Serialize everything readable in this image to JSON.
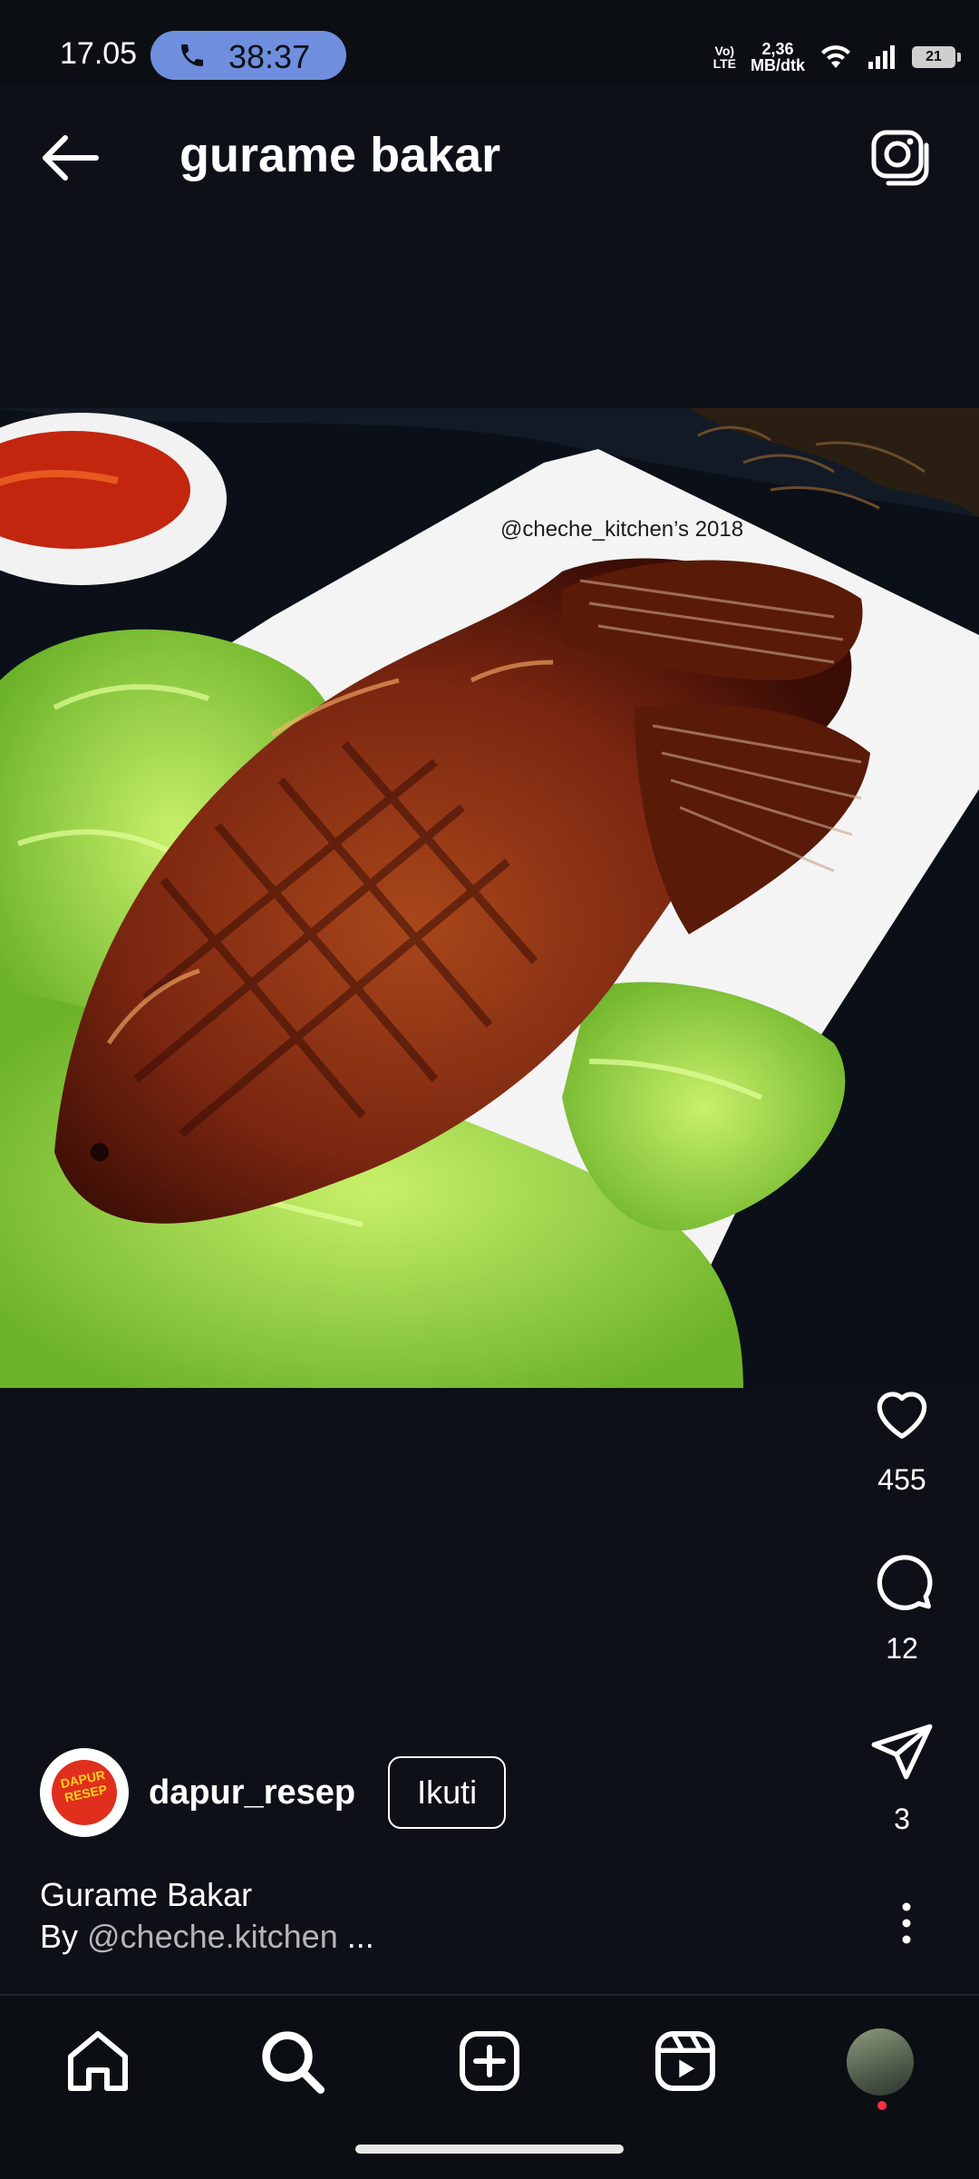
{
  "status_bar": {
    "time": "17.05",
    "call_timer": "38:37",
    "lte_label": "Vo)\nLTE",
    "network_speed": "2,36\nMB/dtk",
    "battery": "21"
  },
  "header": {
    "title": "gurame bakar",
    "back_icon": "arrow-left-icon",
    "camera_icon": "camera-icon"
  },
  "post": {
    "image": "grilled-fish-photo",
    "watermark": "@cheche_kitchen’s 2018",
    "likes": "455",
    "comments": "12",
    "shares": "3"
  },
  "author": {
    "username": "dapur_resep",
    "avatar_text": "DAPUR RESEP",
    "follow_label": "Ikuti"
  },
  "caption": {
    "line1": "Gurame Bakar",
    "by_prefix": "By ",
    "handle": "@cheche.kitchen",
    "ellipsis": " ..."
  },
  "nav": {
    "items": [
      "home-icon",
      "search-icon",
      "add-post-icon",
      "reels-icon",
      "profile-avatar"
    ]
  },
  "colors": {
    "background": "#0d1117",
    "call_pill": "#6f8fde",
    "notification_dot": "#ff3040"
  }
}
